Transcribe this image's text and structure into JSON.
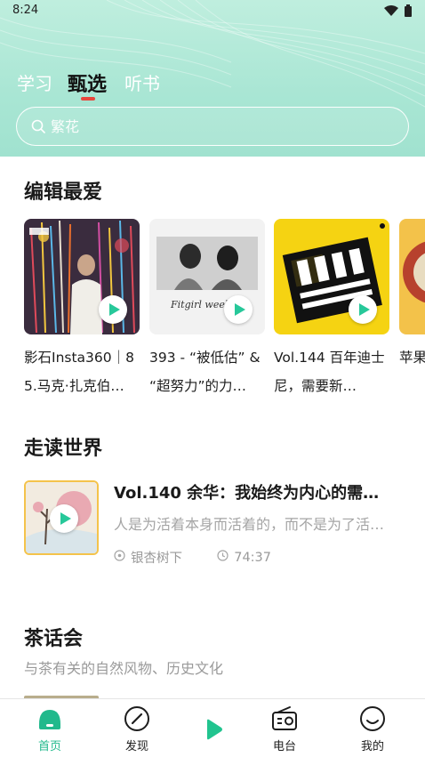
{
  "status_bar": {
    "time": "8:24",
    "wifi_icon": "wifi-icon",
    "battery_icon": "battery-icon"
  },
  "top_tabs": [
    {
      "label": "学习",
      "active": false
    },
    {
      "label": "甄选",
      "active": true
    },
    {
      "label": "听书",
      "active": false
    }
  ],
  "search": {
    "placeholder": "繁花",
    "icon": "search-icon"
  },
  "editors_pick": {
    "title": "编辑最爱",
    "items": [
      {
        "title": "影石Insta360｜85.马克·扎克伯…"
      },
      {
        "title": "393 - “被低估” & “超努力”的力…"
      },
      {
        "title": "Vol.144 百年迪士尼，需要新…"
      },
      {
        "title": "苹果能手"
      }
    ]
  },
  "world_reading": {
    "title": "走读世界",
    "episode": {
      "title": "Vol.140 余华：我始终为内心的需…",
      "description": "人是为活着本身而活着的，而不是为了活…",
      "channel": "银杏树下",
      "duration": "74:37"
    }
  },
  "tea_party": {
    "title": "茶话会",
    "subtitle": "与茶有关的自然风物、历史文化"
  },
  "bottom_nav": [
    {
      "label": "首页",
      "icon": "home-icon",
      "active": true
    },
    {
      "label": "发现",
      "icon": "compass-icon",
      "active": false
    },
    {
      "label": "",
      "icon": "play-icon",
      "active": false
    },
    {
      "label": "电台",
      "icon": "radio-icon",
      "active": false
    },
    {
      "label": "我的",
      "icon": "profile-icon",
      "active": false
    }
  ],
  "colors": {
    "accent": "#21b98c",
    "header": "#a9e6d4",
    "indicator": "#e8463c"
  }
}
